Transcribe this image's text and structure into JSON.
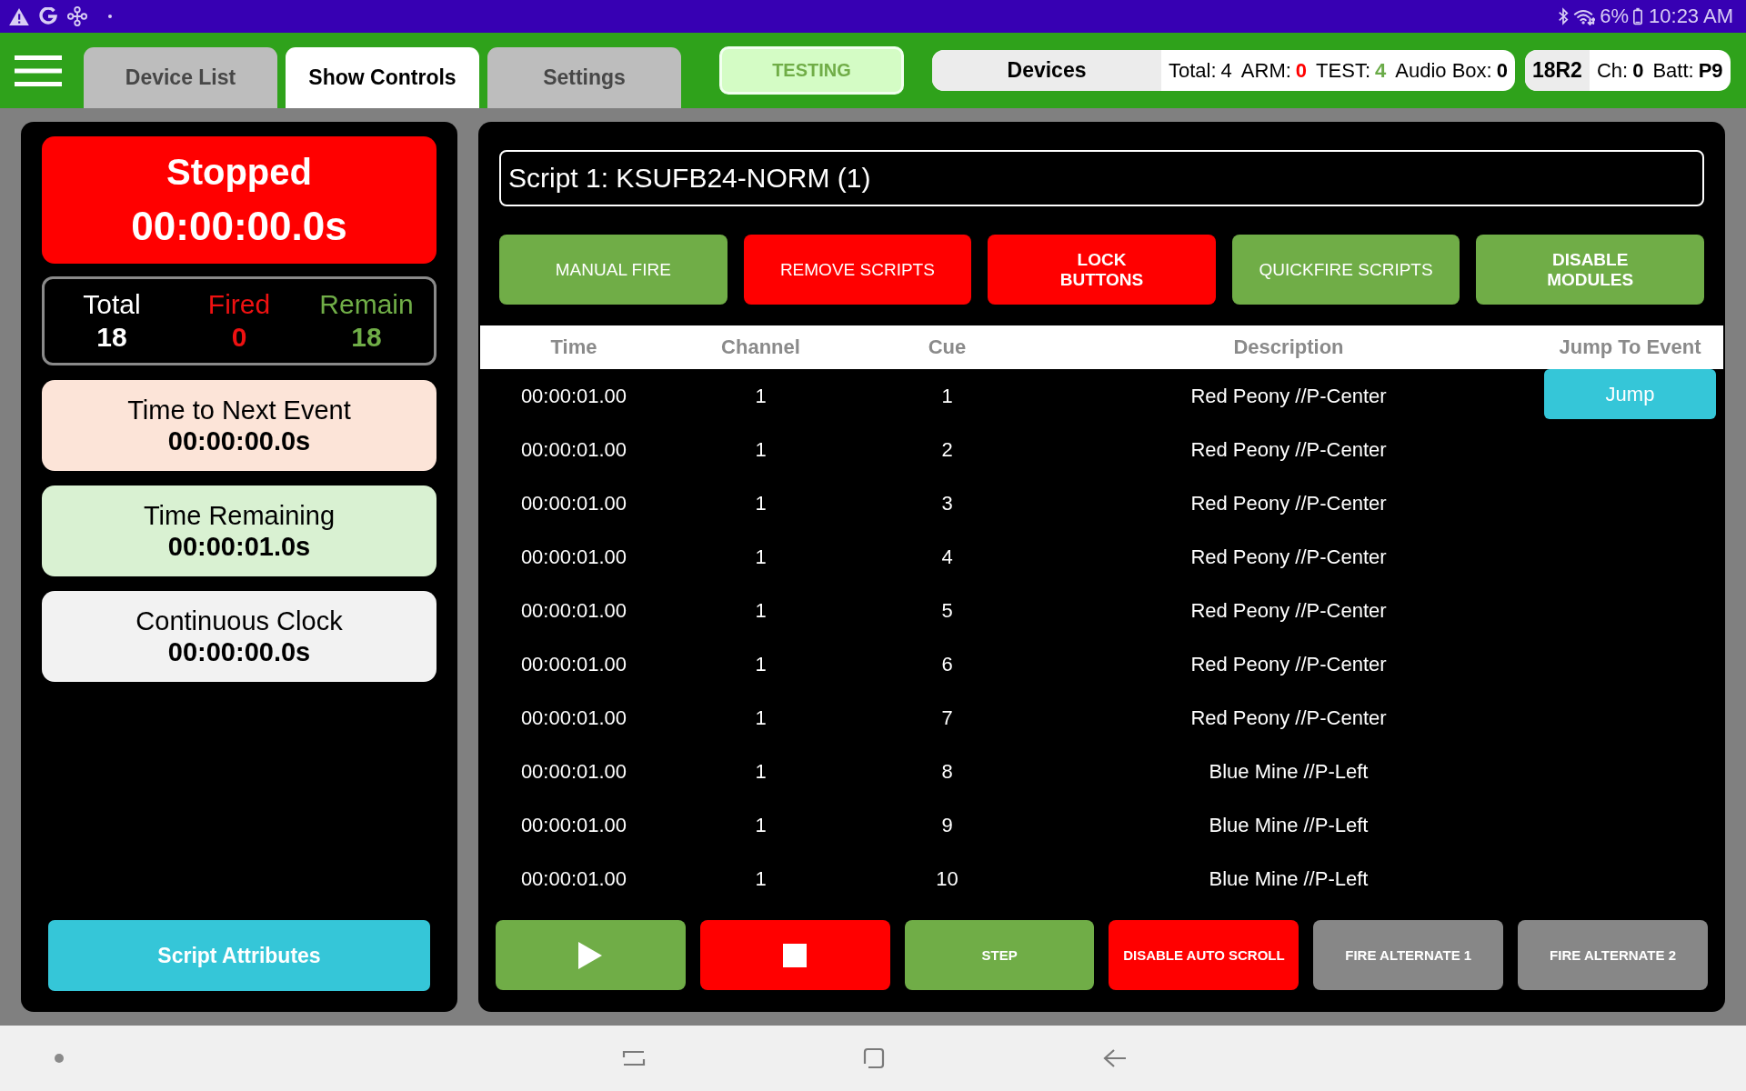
{
  "status_bar": {
    "battery": "6%",
    "time": "10:23 AM"
  },
  "header": {
    "tabs": [
      {
        "label": "Device List",
        "selected": false
      },
      {
        "label": "Show Controls",
        "selected": true
      },
      {
        "label": "Settings",
        "selected": false
      }
    ],
    "mode_button": "TESTING",
    "devices": {
      "label": "Devices",
      "stats": [
        {
          "label": "Total:",
          "value": "4",
          "color": "#000000",
          "bold": false
        },
        {
          "label": "ARM:",
          "value": "0",
          "color": "#ff0000",
          "bold": true
        },
        {
          "label": "TEST:",
          "value": "4",
          "color": "#6aab48",
          "bold": true
        },
        {
          "label": "Audio Box:",
          "value": "0",
          "color": "#000000",
          "bold": true
        }
      ]
    },
    "module": {
      "id": "18R2",
      "stats": [
        {
          "label": "Ch:",
          "value": "0"
        },
        {
          "label": "Batt:",
          "value": "P9"
        }
      ]
    }
  },
  "left_panel": {
    "run_status": {
      "label": "Stopped",
      "time": "00:00:00.0s"
    },
    "counts": [
      {
        "label": "Total",
        "value": "18",
        "color": "#ffffff"
      },
      {
        "label": "Fired",
        "value": "0",
        "color": "#ee1111"
      },
      {
        "label": "Remain",
        "value": "18",
        "color": "#70ad47"
      }
    ],
    "timers": [
      {
        "label": "Time to Next Event",
        "value": "00:00:00.0s",
        "color": "#fce4d8"
      },
      {
        "label": "Time Remaining",
        "value": "00:00:01.0s",
        "color": "#d9f1d2"
      },
      {
        "label": "Continuous Clock",
        "value": "00:00:00.0s",
        "color": "#f2f2f2"
      }
    ],
    "script_attributes_button": "Script Attributes"
  },
  "script_panel": {
    "script": "Script 1: KSUFB24-NORM (1)",
    "actions": [
      {
        "label": "MANUAL FIRE",
        "kind": "action",
        "color": "#70ad47"
      },
      {
        "label": "REMOVE SCRIPTS",
        "kind": "action",
        "color": "#ff0000"
      },
      {
        "label": "LOCK BUTTONS",
        "kind": "toggle",
        "color": "#ff0000"
      },
      {
        "label": "QUICKFIRE SCRIPTS",
        "kind": "action",
        "color": "#70ad47"
      },
      {
        "label": "DISABLE MODULES",
        "kind": "toggle",
        "color": "#70ad47"
      }
    ],
    "table": {
      "columns": [
        "Time",
        "Channel",
        "Cue",
        "Description",
        "Jump To Event"
      ],
      "rows": [
        {
          "time": "00:00:01.00",
          "channel": "1",
          "cue": "1",
          "description": "Red Peony //P-Center",
          "jump": "Jump"
        },
        {
          "time": "00:00:01.00",
          "channel": "1",
          "cue": "2",
          "description": "Red Peony //P-Center"
        },
        {
          "time": "00:00:01.00",
          "channel": "1",
          "cue": "3",
          "description": "Red Peony //P-Center"
        },
        {
          "time": "00:00:01.00",
          "channel": "1",
          "cue": "4",
          "description": "Red Peony //P-Center"
        },
        {
          "time": "00:00:01.00",
          "channel": "1",
          "cue": "5",
          "description": "Red Peony //P-Center"
        },
        {
          "time": "00:00:01.00",
          "channel": "1",
          "cue": "6",
          "description": "Red Peony //P-Center"
        },
        {
          "time": "00:00:01.00",
          "channel": "1",
          "cue": "7",
          "description": "Red Peony //P-Center"
        },
        {
          "time": "00:00:01.00",
          "channel": "1",
          "cue": "8",
          "description": "Blue Mine //P-Left"
        },
        {
          "time": "00:00:01.00",
          "channel": "1",
          "cue": "9",
          "description": "Blue Mine //P-Left"
        },
        {
          "time": "00:00:01.00",
          "channel": "1",
          "cue": "10",
          "description": "Blue Mine //P-Left"
        }
      ]
    },
    "controls": [
      {
        "kind": "play",
        "color": "#70ad47"
      },
      {
        "kind": "stop",
        "color": "#ff0000"
      },
      {
        "kind": "text",
        "label": "STEP",
        "color": "#70ad47"
      },
      {
        "kind": "text",
        "label": "DISABLE AUTO SCROLL",
        "color": "#ff0000"
      },
      {
        "kind": "text",
        "label": "FIRE ALTERNATE 1",
        "color": "#878787"
      },
      {
        "kind": "text",
        "label": "FIRE ALTERNATE 2",
        "color": "#878787"
      }
    ]
  }
}
